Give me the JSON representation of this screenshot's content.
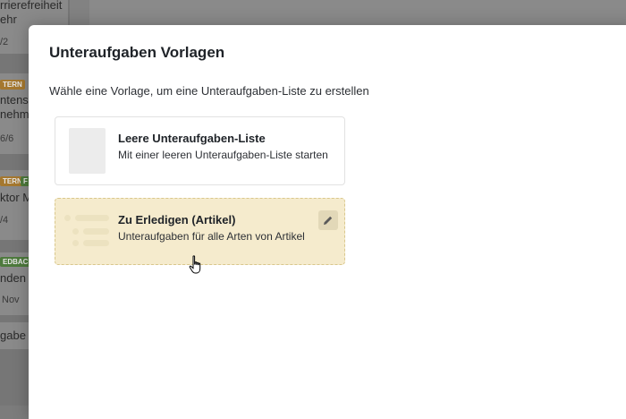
{
  "background": {
    "cards": [
      {
        "line1": "rrierefreiheit",
        "line2": "ehr",
        "meta": "/2"
      },
      {
        "tags": [
          {
            "label": "TERN",
            "color": "#a5782f"
          }
        ],
        "line1": "ntensc",
        "line2": "nehm",
        "meta": "6/6"
      },
      {
        "tags": [
          {
            "label": "TERN",
            "color": "#a5782f"
          },
          {
            "label": "F",
            "color": "#4d7a3c"
          }
        ],
        "line1": "ktor M",
        "meta": "/4"
      },
      {
        "tags": [
          {
            "label": "EDBACK",
            "color": "#4d7a3c"
          }
        ],
        "line1": "nden",
        "meta": "Nov"
      },
      {
        "line1": "gabe"
      }
    ]
  },
  "modal": {
    "title": "Unteraufgaben Vorlagen",
    "subtitle": "Wähle eine Vorlage, um eine Unteraufgaben-Liste zu erstellen",
    "templates": [
      {
        "title": "Leere Unteraufgaben-Liste",
        "description": "Mit einer leeren Unteraufgaben-Liste starten"
      },
      {
        "title": "Zu Erledigen (Artikel)",
        "description": "Unteraufgaben für alle Arten von Artikel"
      }
    ],
    "edit_icon": "pencil-icon"
  },
  "colors": {
    "highlight_bg": "#f5ebcd",
    "highlight_border": "#d9c78c"
  }
}
